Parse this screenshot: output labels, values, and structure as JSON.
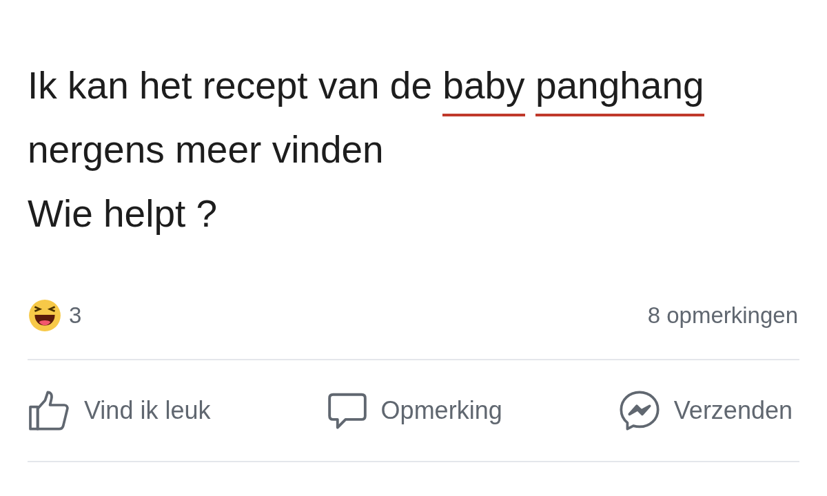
{
  "post": {
    "segments": [
      {
        "text": "Ik kan het recept van de",
        "misspelled": false
      },
      {
        "text": "baby",
        "misspelled": true
      },
      {
        "text": "panghang",
        "misspelled": true
      },
      {
        "text": "nergens meer vinden\nWie helpt ?",
        "misspelled": false
      }
    ]
  },
  "reactions": {
    "count": "3"
  },
  "comments_count": "8 opmerkingen",
  "actions": [
    {
      "kind": "like",
      "label": "Vind ik leuk"
    },
    {
      "kind": "comment",
      "label": "Opmerking"
    },
    {
      "kind": "send",
      "label": "Verzenden"
    }
  ]
}
